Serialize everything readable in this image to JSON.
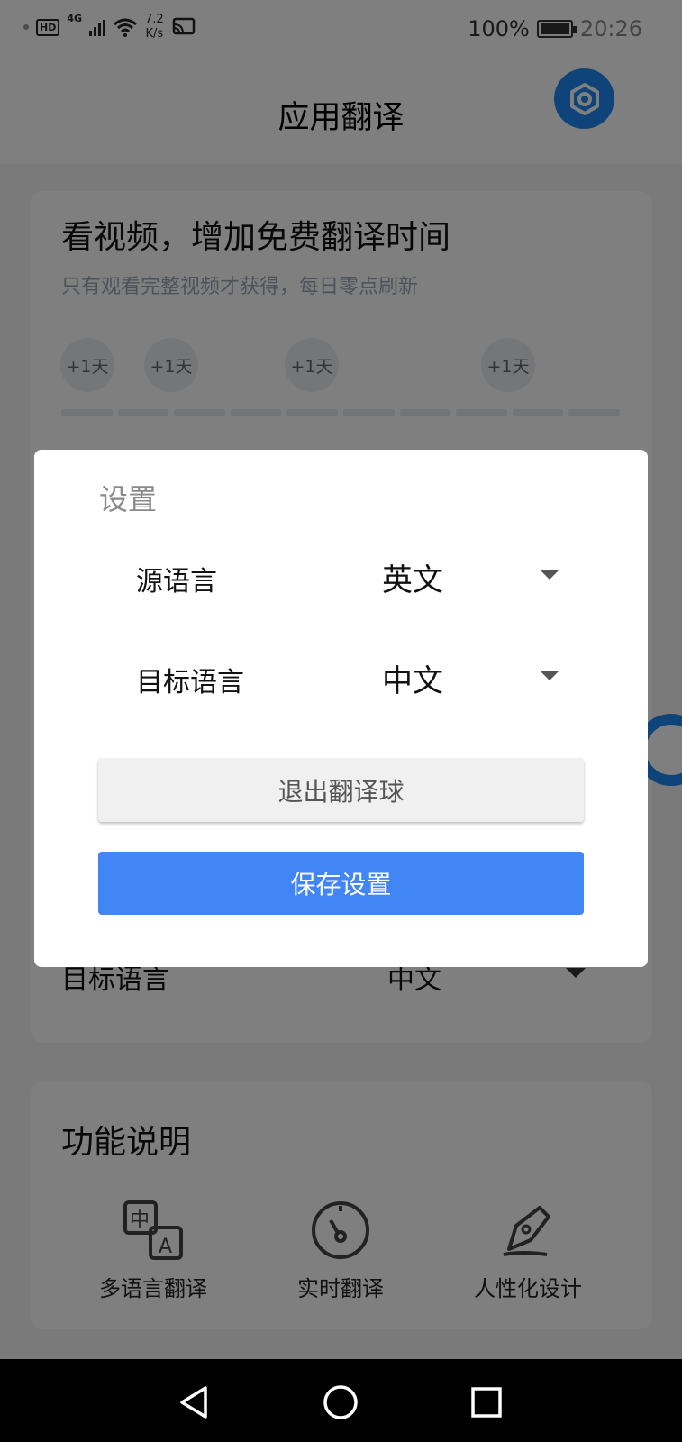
{
  "status_bar": {
    "hd": "HD",
    "network": "4G",
    "speed_value": "7.2",
    "speed_unit": "K/s",
    "battery": "100%",
    "time": "20:26"
  },
  "header": {
    "title": "应用翻译",
    "settings_icon": "gear-icon"
  },
  "promo_card": {
    "title": "看视频，增加免费翻译时间",
    "subtitle": "只有观看完整视频才获得，每日零点刷新",
    "bubbles": [
      "+1天",
      "+1天",
      "+1天",
      "+1天"
    ],
    "progress_segments": 10
  },
  "background_row": {
    "label": "目标语言",
    "value": "中文"
  },
  "features_card": {
    "title": "功能说明",
    "items": [
      {
        "label": "多语言翻译",
        "icon": "translate-icon"
      },
      {
        "label": "实时翻译",
        "icon": "speedometer-icon"
      },
      {
        "label": "人性化设计",
        "icon": "pen-icon"
      }
    ]
  },
  "dialog": {
    "title": "设置",
    "source_language_label": "源语言",
    "source_language_value": "英文",
    "target_language_label": "目标语言",
    "target_language_value": "中文",
    "exit_button": "退出翻译球",
    "save_button": "保存设置"
  },
  "colors": {
    "accent": "#1e88f5",
    "save_button": "#4285f4",
    "scrim": "rgba(0,0,0,0.5)"
  }
}
